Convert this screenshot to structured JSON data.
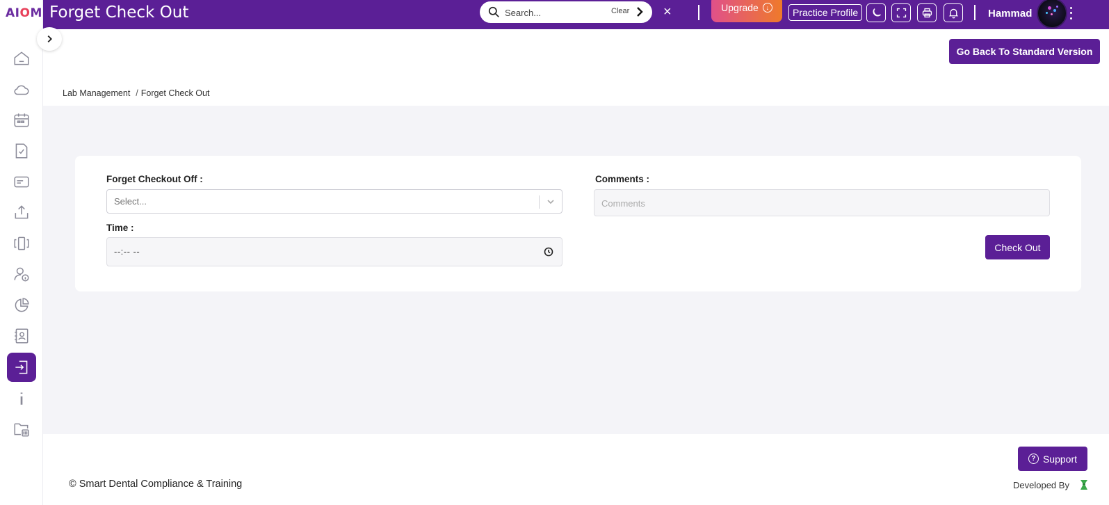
{
  "app": {
    "logo_text_a": "AI",
    "logo_text_o": "O",
    "logo_text_m": "M",
    "page_title": "Forget Check Out",
    "brand_color": "#5b1f96"
  },
  "header": {
    "search_placeholder": "Search...",
    "clear_label": "Clear",
    "close_symbol": "×",
    "upgrade_label": "Upgrade",
    "practice_profile_label": "Practice Profile",
    "username": "Hammad",
    "icons": [
      "moon-icon",
      "fullscreen-icon",
      "print-icon",
      "bell-icon"
    ]
  },
  "subheader": {
    "standard_version_label": "Go Back To Standard Version"
  },
  "breadcrumb": {
    "parent": "Lab Management",
    "separator": "/",
    "current": "Forget Check Out"
  },
  "form": {
    "forget_checkout_label": "Forget Checkout Off :",
    "forget_checkout_placeholder": "Select...",
    "time_label": "Time :",
    "time_value": "--:-- --",
    "comments_label": "Comments :",
    "comments_placeholder": "Comments",
    "checkout_label": "Check Out"
  },
  "sidebar": {
    "items": [
      "home-icon",
      "cloud-icon",
      "calendar-icon",
      "checklist-icon",
      "card-icon",
      "upload-icon",
      "compare-icon",
      "user-info-icon",
      "pie-chart-icon",
      "contact-book-icon",
      "checkout-icon",
      "info-icon",
      "folder-delete-icon"
    ],
    "active": "checkout-icon"
  },
  "footer": {
    "support_label": "Support",
    "copyright": "© Smart Dental Compliance & Training",
    "developed_by": "Developed By"
  }
}
